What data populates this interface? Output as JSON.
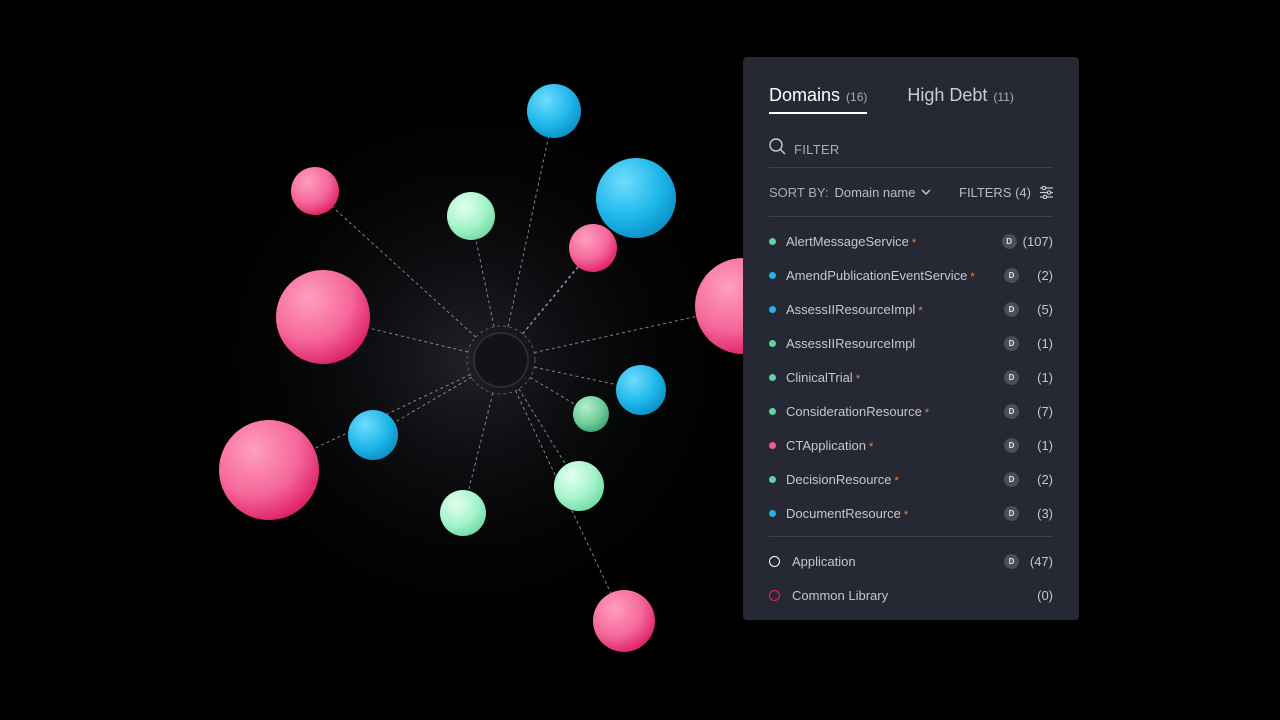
{
  "tabs": [
    {
      "label": "Domains",
      "count": "(16)"
    },
    {
      "label": "High Debt",
      "count": "(11)"
    }
  ],
  "filter": {
    "placeholder": "FILTER"
  },
  "sort": {
    "label": "SORT BY:",
    "value": "Domain name"
  },
  "filters": {
    "label": "FILTERS (4)"
  },
  "items": [
    {
      "name": "AlertMessageService",
      "star": "*",
      "badge": "D",
      "count": "(107)",
      "color": "#5fd39b"
    },
    {
      "name": "AmendPublicationEventService",
      "star": "*",
      "badge": "D",
      "count": "(2)",
      "color": "#1fb5e8"
    },
    {
      "name": "AssessIIResourceImpl",
      "star": "*",
      "badge": "D",
      "count": "(5)",
      "color": "#1fb5e8"
    },
    {
      "name": "AssessIIResourceImpl",
      "star": "",
      "badge": "D",
      "count": "(1)",
      "color": "#5fd39b"
    },
    {
      "name": "ClinicalTrial",
      "star": "*",
      "badge": "D",
      "count": "(1)",
      "color": "#5fd39b"
    },
    {
      "name": "ConsiderationResource",
      "star": "*",
      "badge": "D",
      "count": "(7)",
      "color": "#5fd39b"
    },
    {
      "name": "CTApplication",
      "star": "*",
      "badge": "D",
      "count": "(1)",
      "color": "#f2588f"
    },
    {
      "name": "DecisionResource",
      "star": "*",
      "badge": "D",
      "count": "(2)",
      "color": "#5fd39b"
    },
    {
      "name": "DocumentResource",
      "star": "*",
      "badge": "D",
      "count": "(3)",
      "color": "#1fb5e8"
    }
  ],
  "legend": [
    {
      "name": "Application",
      "badge": "D",
      "count": "(47)",
      "color": "#ffffff"
    },
    {
      "name": "Common Library",
      "badge": "",
      "count": "(0)",
      "color": "#e0246a"
    }
  ],
  "colors": {
    "pink": "#f2588f",
    "cyan": "#1fb5e8",
    "mint": "#9ef2c6",
    "green": "#6fd19e",
    "hub": "#121318"
  },
  "graph_nodes": [
    {
      "color": "cyan"
    },
    {
      "color": "pink"
    },
    {
      "color": "mint"
    },
    {
      "color": "cyan"
    },
    {
      "color": "pink"
    },
    {
      "color": "pink"
    },
    {
      "color": "pink"
    },
    {
      "color": "cyan"
    },
    {
      "color": "cyan"
    },
    {
      "color": "green"
    },
    {
      "color": "pink"
    },
    {
      "color": "mint"
    },
    {
      "color": "mint"
    },
    {
      "color": "pink"
    }
  ]
}
